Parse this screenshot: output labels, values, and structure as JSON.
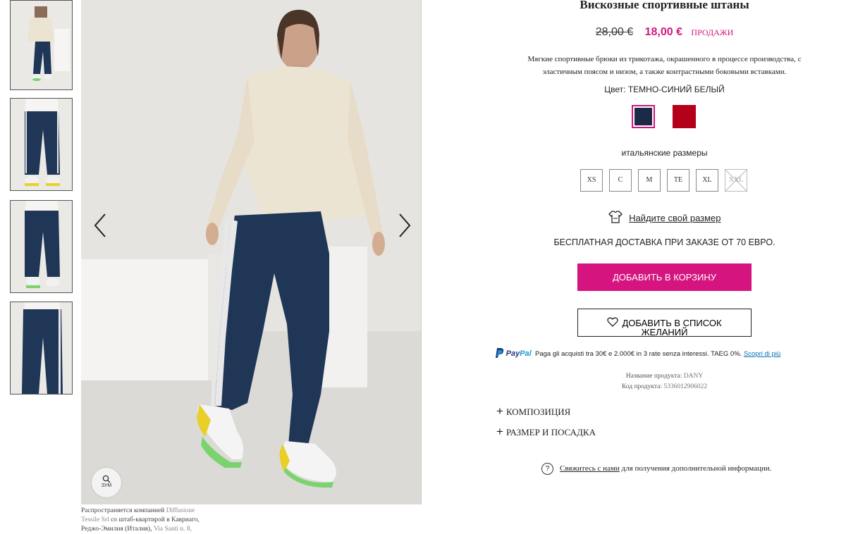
{
  "product": {
    "title": "Вискозные спортивные штаны",
    "old_price": "28,00 €",
    "new_price": "18,00 €",
    "sale_label": "ПРОДАЖИ",
    "description": "Мягкие спортивные брюки из трикотажа, окрашенного в процессе производства, с эластичным поясом и низом, а также контрастными боковыми вставками.",
    "color_label": "Цвет:",
    "color_value": "ТЕМНО-СИНИЙ БЕЛЫЙ",
    "swatches": [
      {
        "name": "navy",
        "color": "#1c2a48",
        "selected": true
      },
      {
        "name": "red",
        "color": "#b5001a",
        "selected": false
      }
    ],
    "sizes_label": "итальянские размеры",
    "sizes": [
      {
        "label": "XS",
        "available": true
      },
      {
        "label": "C",
        "available": true
      },
      {
        "label": "M",
        "available": true
      },
      {
        "label": "TE",
        "available": true
      },
      {
        "label": "XL",
        "available": true
      },
      {
        "label": "XXL",
        "available": false
      }
    ],
    "find_size": "Найдите свой размер",
    "shipping": "БЕСПЛАТНАЯ ДОСТАВКА ПРИ ЗАКАЗЕ ОТ 70 ЕВРО.",
    "add_to_cart": "ДОБАВИТЬ В КОРЗИНУ",
    "wishlist_line1": "ДОБАВИТЬ В СПИСОК",
    "wishlist_line2": "ЖЕЛАНИЙ",
    "paypal_brand_1": "Pay",
    "paypal_brand_2": "Pal",
    "paypal_text": "Paga gli acquisti tra 30€ e 2.000€ in 3 rate senza interessi. TAEG 0%.",
    "paypal_link": "Scopri di più",
    "product_name_label": "Название продукта:",
    "product_name_value": "DANY",
    "product_code_label": "Код продукта:",
    "product_code_value": "5336012906022",
    "accordions": [
      "КОМПОЗИЦИЯ",
      "РАЗМЕР И ПОСАДКА"
    ],
    "contact_link": "Свяжитесь с нами",
    "contact_text": "для получения дополнительной информации."
  },
  "gallery": {
    "zoom_label": "ЗУМ",
    "credit_1": "Распространяется компанией",
    "credit_2": "Diffusione",
    "credit_3": "Tessile Srl",
    "credit_4": "со штаб-квартирой в Кавриаго,",
    "credit_5": "Реджо-Эмилия (Италия),",
    "credit_6": "Via Santi n. 8,",
    "colors": {
      "pants": "#1f3657",
      "sweater": "#ece4d3",
      "background": "#e6e4e1",
      "accent": "#d5147f"
    }
  }
}
